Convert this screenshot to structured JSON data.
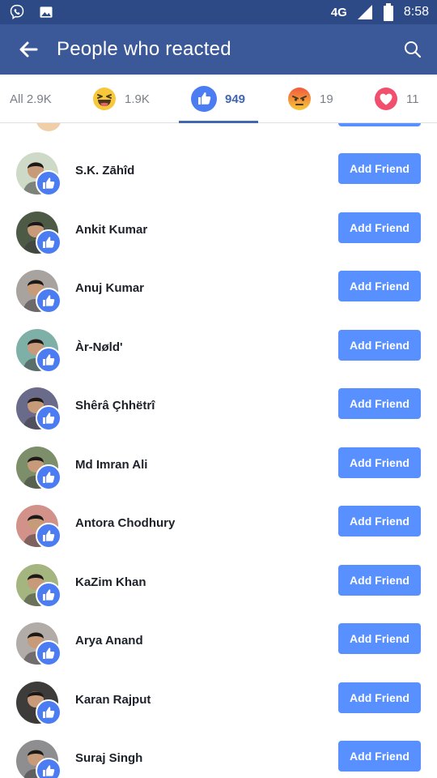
{
  "statusbar": {
    "network": "4G",
    "time": "8:58",
    "icons": [
      "viber-icon",
      "gallery-icon",
      "signal-icon",
      "battery-icon"
    ]
  },
  "appbar": {
    "title": "People who reacted",
    "back_icon": "arrow-left-icon",
    "search_icon": "search-icon",
    "color": "#3b5998"
  },
  "tabs": [
    {
      "id": "all",
      "label": "All 2.9K"
    },
    {
      "id": "haha",
      "icon": "haha-emoji-icon",
      "count": "1.9K"
    },
    {
      "id": "like",
      "icon": "like-icon",
      "count": "949",
      "active": true
    },
    {
      "id": "angry",
      "icon": "angry-emoji-icon",
      "count": "19"
    },
    {
      "id": "love",
      "icon": "love-icon",
      "count": "11"
    }
  ],
  "button_label": "Add Friend",
  "people": [
    {
      "name": "S.K. Zāhîd",
      "avatar_color": "#cfd9c7"
    },
    {
      "name": "Ankit Kumar",
      "avatar_color": "#4d5a46"
    },
    {
      "name": "Anuj Kumar",
      "avatar_color": "#a9a3a0"
    },
    {
      "name": "Àr-Nøld'",
      "avatar_color": "#7fb0a8"
    },
    {
      "name": "Shêrâ Çhhëtrî",
      "avatar_color": "#6a6b8a"
    },
    {
      "name": "Md Imran Ali",
      "avatar_color": "#7c8e6a"
    },
    {
      "name": "Antora Chodhury",
      "avatar_color": "#d2928a"
    },
    {
      "name": "KaZim Khan",
      "avatar_color": "#a5b57f"
    },
    {
      "name": "Arya Anand",
      "avatar_color": "#b1aca8"
    },
    {
      "name": "Karan Rajput",
      "avatar_color": "#3e3c3a"
    },
    {
      "name": "Suraj Singh",
      "avatar_color": "#8e8e90"
    }
  ],
  "colors": {
    "accent": "#4267b2",
    "button": "#5890ff",
    "like_badge": "#4c7cf2"
  }
}
